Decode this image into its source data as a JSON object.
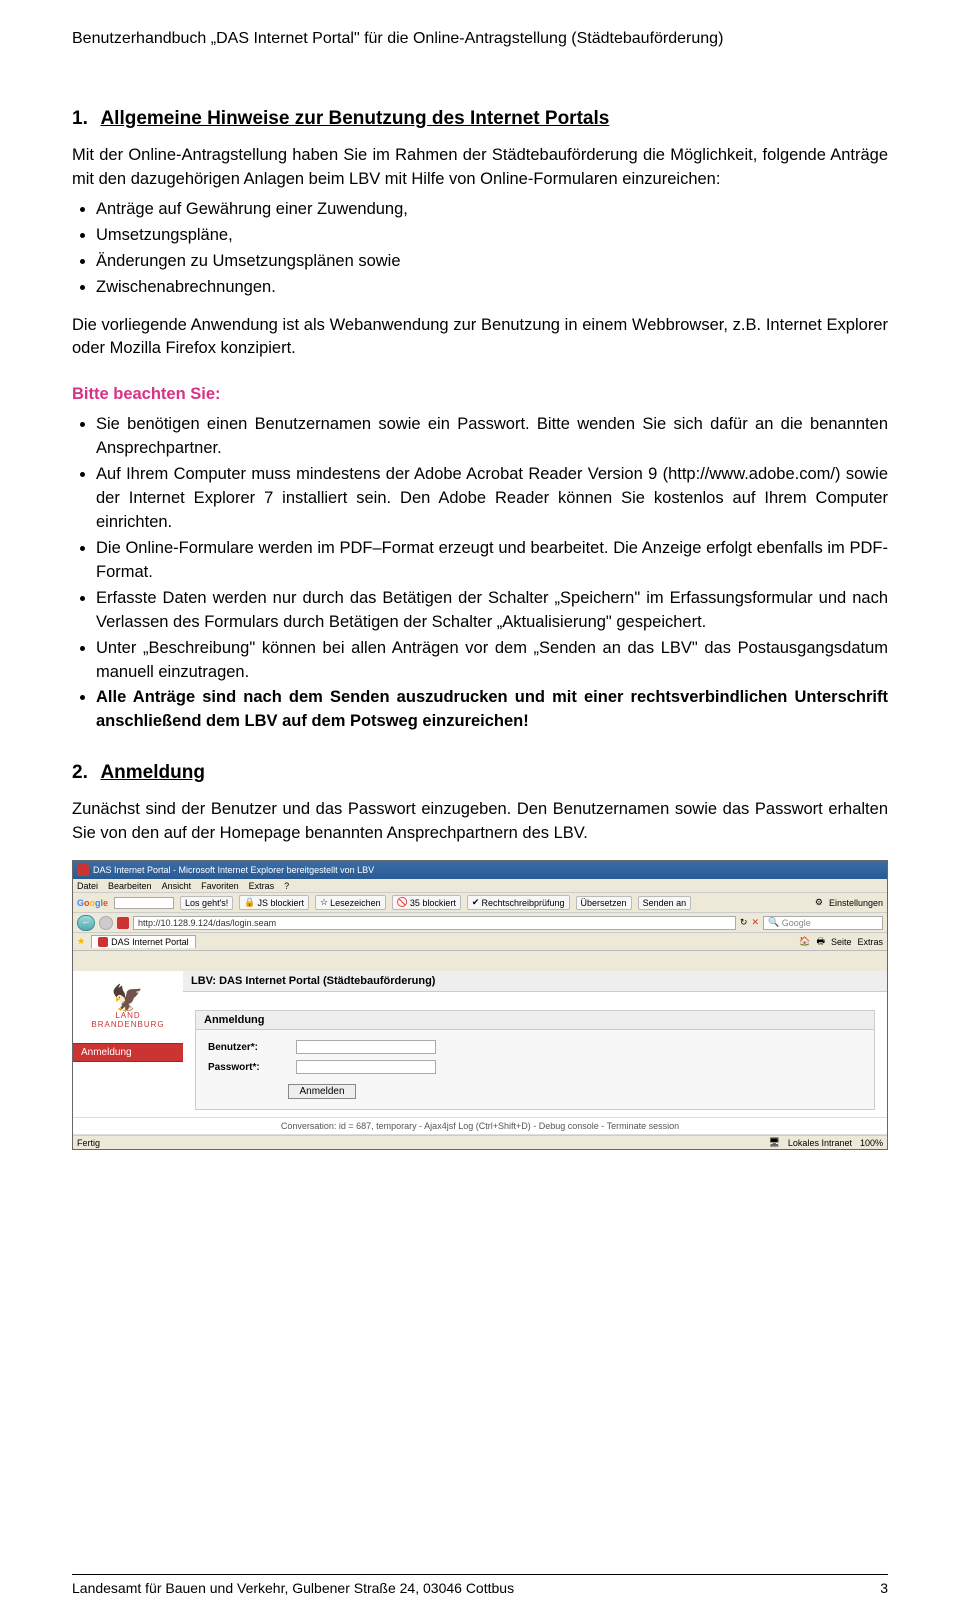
{
  "header": "Benutzerhandbuch „DAS Internet Portal\" für die Online-Antragstellung (Städtebauförderung)",
  "sec1": {
    "num": "1.",
    "title": "Allgemeine Hinweise zur Benutzung des Internet Portals",
    "intro": "Mit der Online-Antragstellung haben Sie im Rahmen der Städtebauförderung die Möglichkeit, folgende Anträge mit den dazugehörigen Anlagen beim LBV mit Hilfe von Online-Formularen einzureichen:",
    "bullets_a": [
      "Anträge auf Gewährung einer Zuwendung,",
      "Umsetzungspläne,",
      "Änderungen zu Umsetzungsplänen sowie",
      "Zwischenabrechnungen."
    ],
    "para2": "Die vorliegende Anwendung ist als Webanwendung zur Benutzung in einem Webbrowser, z.B. Internet Explorer oder Mozilla Firefox konzipiert.",
    "notice_h": "Bitte beachten Sie:",
    "bullets_b": [
      "Sie benötigen einen Benutzernamen sowie ein Passwort. Bitte wenden Sie sich dafür an die benannten Ansprechpartner.",
      "Auf Ihrem Computer muss mindestens der Adobe Acrobat Reader Version 9 (http://www.adobe.com/) sowie der Internet Explorer 7 installiert sein. Den Adobe Reader können Sie kostenlos auf Ihrem Computer einrichten.",
      "Die Online-Formulare werden im PDF–Format erzeugt und bearbeitet. Die Anzeige erfolgt ebenfalls im PDF-Format.",
      "Erfasste Daten werden nur durch das Betätigen der Schalter „Speichern\" im Erfassungsformular und nach Verlassen des Formulars durch Betätigen der Schalter „Aktualisierung\" gespeichert.",
      "Unter „Beschreibung\" können bei allen Anträgen vor dem „Senden an das LBV\" das Postausgangsdatum manuell einzutragen.",
      "Alle Anträge sind nach dem Senden auszudrucken und mit einer rechtsverbindlichen Unterschrift anschließend dem LBV auf dem Potsweg einzureichen!"
    ]
  },
  "sec2": {
    "num": "2.",
    "title": "Anmeldung",
    "para": "Zunächst sind der Benutzer und das Passwort  einzugeben. Den Benutzernamen sowie das Passwort erhalten Sie von den auf der Homepage benannten Ansprechpartnern des LBV."
  },
  "screenshot": {
    "title": "DAS Internet Portal - Microsoft Internet Explorer bereitgestellt von LBV",
    "menus": [
      "Datei",
      "Bearbeiten",
      "Ansicht",
      "Favoriten",
      "Extras",
      "?"
    ],
    "g_items": [
      "Los geht's!",
      "JS blockiert",
      "Lesezeichen",
      "35 blockiert",
      "Rechtschreibprüfung",
      "Übersetzen",
      "Senden an"
    ],
    "g_settings": "Einstellungen",
    "url": "http://10.128.9.124/das/login.seam",
    "search_ph": "Google",
    "tab": "DAS Internet Portal",
    "tab_right": [
      "Seite",
      "Extras"
    ],
    "portal_hdr": "LBV: DAS Internet Portal (Städtebauförderung)",
    "logo_l1": "LAND",
    "logo_l2": "BRANDENBURG",
    "side_item": "Anmeldung",
    "panel_hdr": "Anmeldung",
    "lbl_user": "Benutzer*:",
    "lbl_pass": "Passwort*:",
    "btn": "Anmelden",
    "debug": "Conversation: id = 687, temporary - Ajax4jsf Log (Ctrl+Shift+D) - Debug console - Terminate session",
    "status_l": "Fertig",
    "status_r1": "Lokales Intranet",
    "status_r2": "100%"
  },
  "footer": {
    "left": "Landesamt für Bauen und Verkehr, Gulbener Straße 24, 03046 Cottbus",
    "right": "3"
  }
}
